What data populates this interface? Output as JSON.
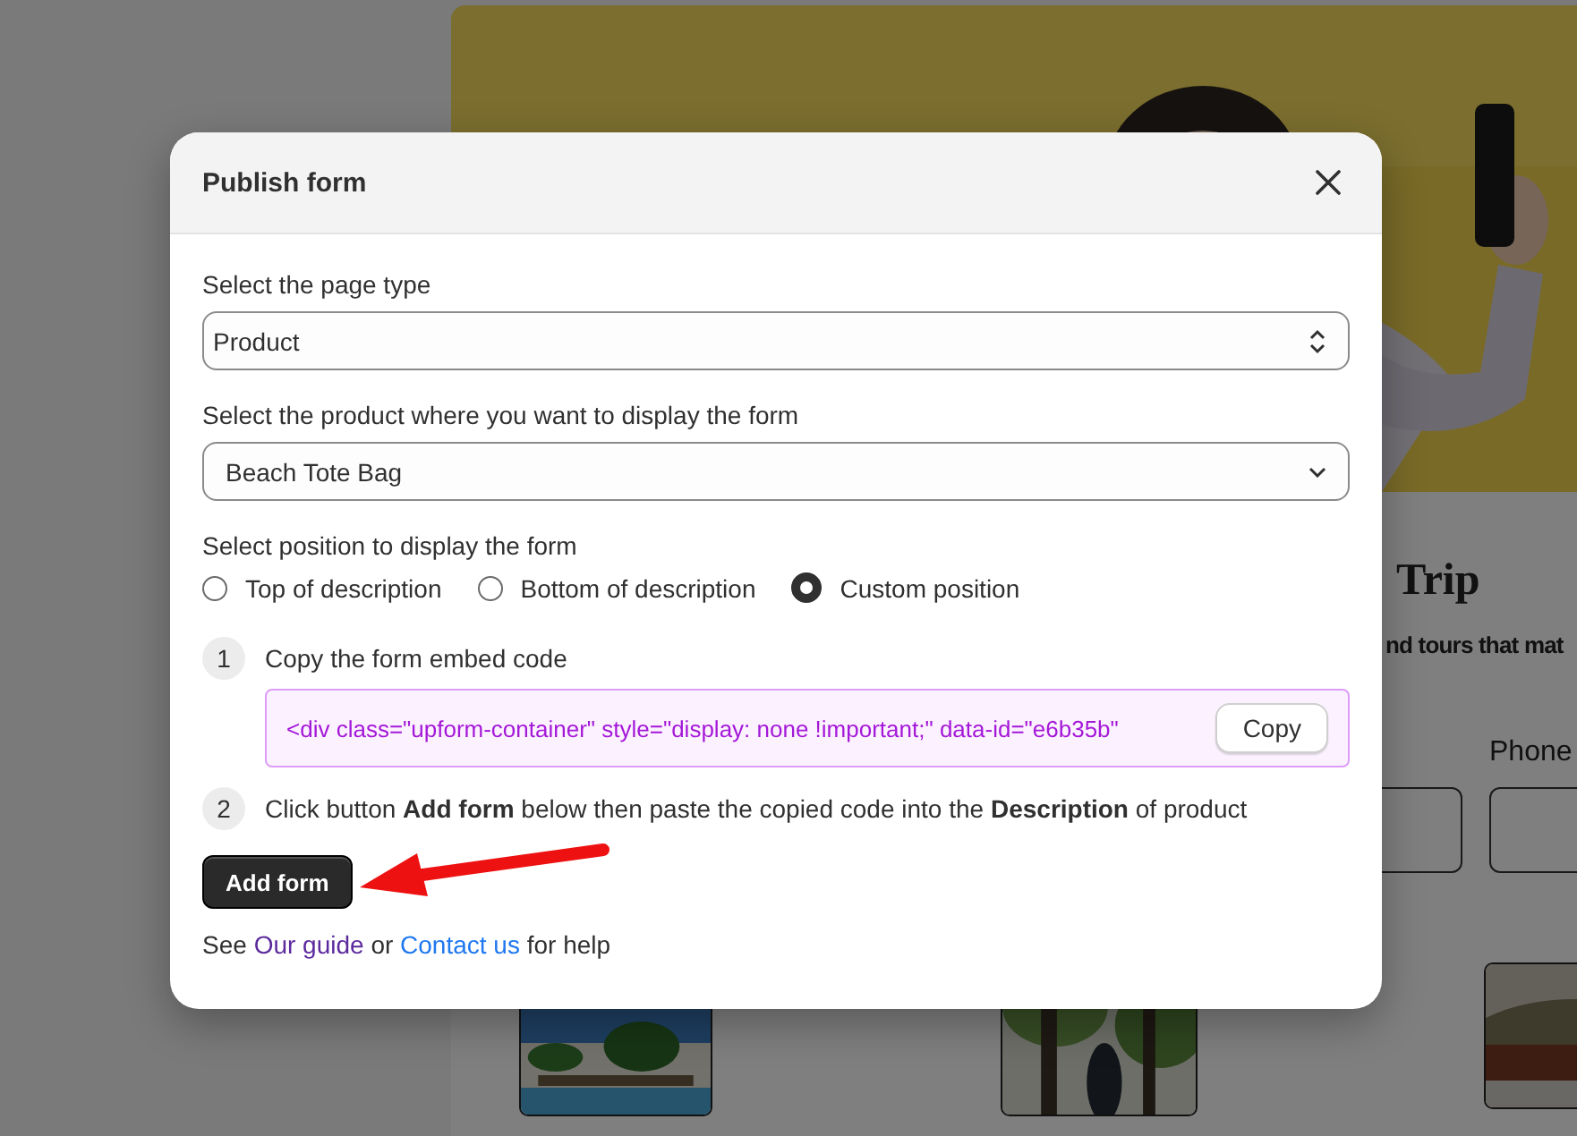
{
  "background_page": {
    "heading": "Trip",
    "subtitle": "nd tours that mat",
    "field_label": "Phone"
  },
  "dialog": {
    "title": "Publish form",
    "page_type": {
      "label": "Select the page type",
      "value": "Product"
    },
    "product": {
      "label": "Select the product where you want to display the form",
      "value": "Beach Tote Bag"
    },
    "position": {
      "label": "Select position to display the form",
      "options": [
        {
          "label": "Top of description",
          "selected": false
        },
        {
          "label": "Bottom of description",
          "selected": false
        },
        {
          "label": "Custom position",
          "selected": true
        }
      ]
    },
    "steps": [
      {
        "number": "1",
        "text": "Copy the form embed code",
        "code": "<div class=\"upform-container\" style=\"display: none !important;\" data-id=\"e6b35b\"",
        "copy_button": "Copy"
      },
      {
        "number": "2",
        "text": "Click button **Add form** below then paste the copied code into the **Description** of product"
      }
    ],
    "add_button": "Add form",
    "help": [
      {
        "kind": "text",
        "text": "See"
      },
      {
        "kind": "link",
        "text": "Our guide",
        "visited": true
      },
      {
        "kind": "text",
        "text": "or"
      },
      {
        "kind": "link",
        "text": "Contact us",
        "visited": false
      },
      {
        "kind": "text",
        "text": "for help"
      }
    ]
  }
}
